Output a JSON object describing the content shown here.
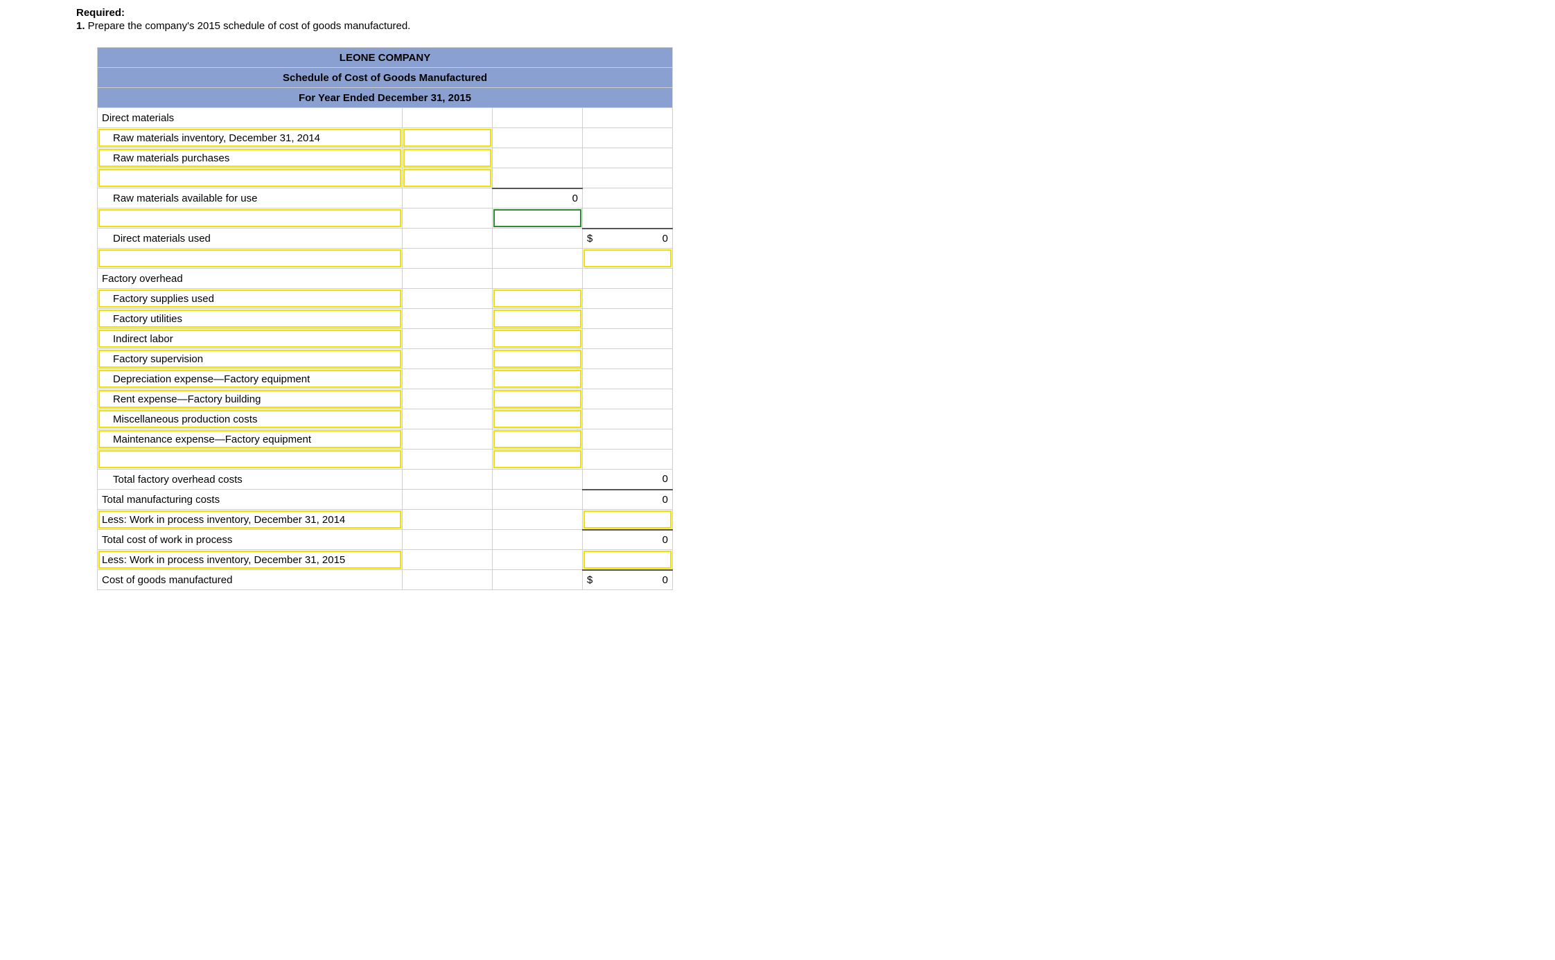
{
  "heading": {
    "required": "Required:",
    "qnum": "1.",
    "question": " Prepare the company's 2015 schedule of cost of goods manufactured."
  },
  "header": {
    "company": "LEONE COMPANY",
    "title": "Schedule of Cost of Goods Manufactured",
    "period": "For Year Ended December 31, 2015"
  },
  "rows": {
    "direct_materials": "Direct materials",
    "rmi_beg": "Raw materials inventory, December 31, 2014",
    "rmp": "Raw materials purchases",
    "rma": "Raw materials available for use",
    "rma_val": "0",
    "dmu": "Direct materials used",
    "dmu_sym": "$",
    "dmu_val": "0",
    "foh": "Factory overhead",
    "fsu": "Factory supplies used",
    "fut": "Factory utilities",
    "il": "Indirect labor",
    "fsup": "Factory supervision",
    "dep": "Depreciation expense—Factory equipment",
    "rent": "Rent expense—Factory building",
    "misc": "Miscellaneous production costs",
    "maint": "Maintenance expense—Factory equipment",
    "tfoh": "Total factory overhead costs",
    "tfoh_val": "0",
    "tmc": "Total manufacturing costs",
    "tmc_val": "0",
    "wip_beg": "Less: Work in process inventory, December 31, 2014",
    "tcwip": "Total cost of work in process",
    "tcwip_val": "0",
    "wip_end": "Less: Work in process inventory, December 31, 2015",
    "cogm": "Cost of goods manufactured",
    "cogm_sym": "$",
    "cogm_val": "0"
  }
}
